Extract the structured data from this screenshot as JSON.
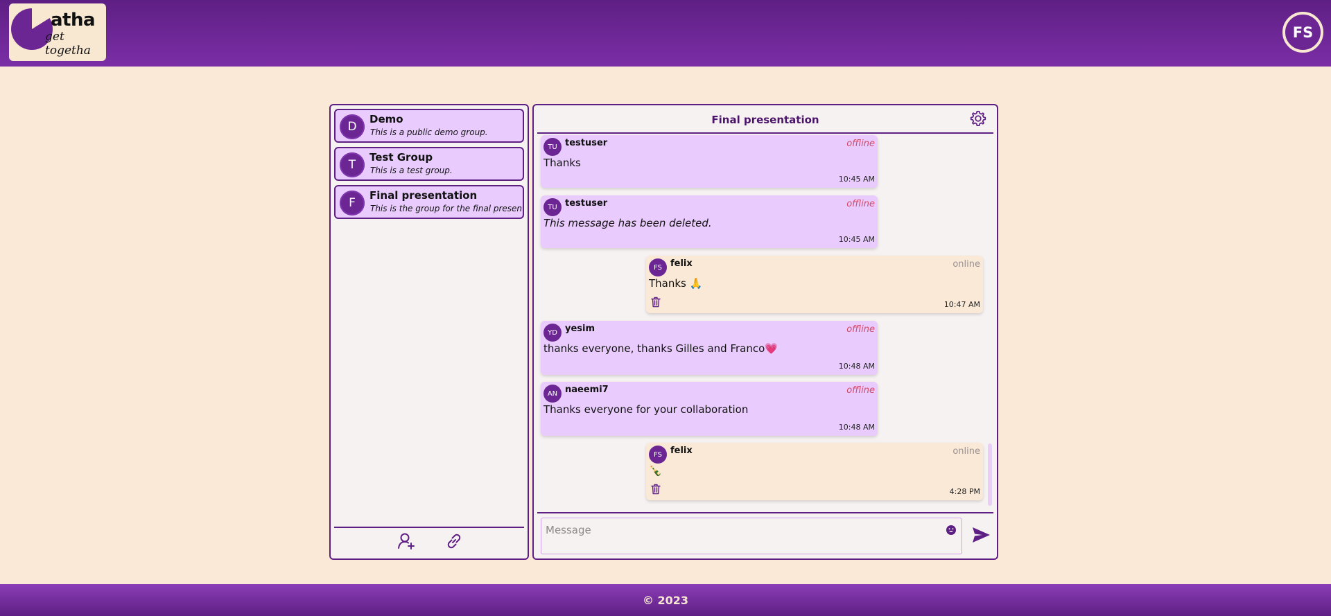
{
  "app": {
    "logo_text": "atha",
    "logo_tagline": "get togetha",
    "user_initials": "FS"
  },
  "groups": [
    {
      "initial": "D",
      "name": "Demo",
      "description": "This is a public demo group."
    },
    {
      "initial": "T",
      "name": "Test Group",
      "description": "This is a test group."
    },
    {
      "initial": "F",
      "name": "Final presentation",
      "description": "This is the group for the final presentation."
    }
  ],
  "groups_toolbar": {
    "icons": [
      "add-member-icon",
      "link-icon"
    ]
  },
  "chat": {
    "title": "Final presentation",
    "messages": [
      {
        "initials": "TU",
        "user": "testuser",
        "status": "offline",
        "text": "Thanks",
        "time": "10:45 AM",
        "mine": false,
        "deleted": false
      },
      {
        "initials": "TU",
        "user": "testuser",
        "status": "offline",
        "text": "This message has been deleted.",
        "time": "10:45 AM",
        "mine": false,
        "deleted": true
      },
      {
        "initials": "FS",
        "user": "felix",
        "status": "online",
        "text": "Thanks 🙏",
        "time": "10:47 AM",
        "mine": true,
        "deleted": false
      },
      {
        "initials": "YD",
        "user": "yesim",
        "status": "offline",
        "text": "thanks everyone, thanks Gilles and Franco💗",
        "time": "10:48 AM",
        "mine": false,
        "deleted": false
      },
      {
        "initials": "AN",
        "user": "naeemi7",
        "status": "offline",
        "text": "Thanks everyone for your collaboration",
        "time": "10:48 AM",
        "mine": false,
        "deleted": false
      },
      {
        "initials": "FS",
        "user": "felix",
        "status": "online",
        "text": "🍾",
        "time": "4:28 PM",
        "mine": true,
        "deleted": false
      }
    ],
    "input_placeholder": "Message",
    "input_value": ""
  },
  "footer": {
    "text": "© 2023"
  },
  "colors": {
    "primary": "#6b2694",
    "background": "#f9e9d6",
    "bubble_other": "#e9ccfd",
    "bubble_mine": "#f9e9d6",
    "offline": "#d24a6a"
  }
}
